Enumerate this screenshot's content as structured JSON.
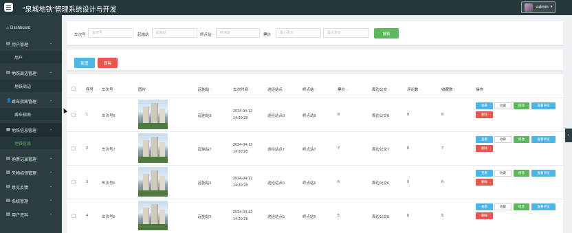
{
  "app": {
    "title": "“泉城地铁”管理系统设计与开发",
    "user": "admin",
    "caret": "▾"
  },
  "sidebar": {
    "items": [
      {
        "icon": "⌂",
        "icon_name": "home-icon",
        "label": "Dashboard",
        "chevron": ""
      },
      {
        "icon": "▤",
        "icon_name": "user-group-icon",
        "label": "用户管理",
        "chevron": "⌄"
      },
      {
        "sub": true,
        "label": "用户"
      },
      {
        "icon": "▤",
        "icon_name": "grid-icon",
        "label": "地铁周边管理",
        "chevron": "⌄"
      },
      {
        "sub": true,
        "label": "地铁周边"
      },
      {
        "icon": "👤",
        "icon_name": "guide-user-icon",
        "label": "乘车指南管理",
        "chevron": "⌄"
      },
      {
        "sub": true,
        "label": "乘车指南"
      },
      {
        "icon": "▦",
        "icon_name": "grid-icon",
        "label": "地铁信息管理",
        "chevron": "⌄",
        "active": true
      },
      {
        "sub": true,
        "label": "地铁信息",
        "active": true
      },
      {
        "icon": "▤",
        "icon_name": "ticket-icon",
        "label": "购票记录管理",
        "chevron": "⌄"
      },
      {
        "icon": "▤",
        "icon_name": "lost-found-icon",
        "label": "失物招领管理",
        "chevron": "⌄"
      },
      {
        "icon": "▤",
        "icon_name": "feedback-icon",
        "label": "意见反馈",
        "chevron": "⌄"
      },
      {
        "icon": "▤",
        "icon_name": "system-icon",
        "label": "系统管理",
        "chevron": "⌄"
      },
      {
        "icon": "▤",
        "icon_name": "profile-icon",
        "label": "用户资料",
        "chevron": "⌄"
      }
    ]
  },
  "search": {
    "train_no_label": "车次号",
    "train_no_placeholder": "车次号",
    "start_label": "起始站",
    "start_placeholder": "起始站",
    "end_label": "终点站",
    "end_placeholder": "终点站",
    "fare_label": "票价",
    "fare_min_placeholder": "最小票价",
    "fare_max_placeholder": "最大票价",
    "button": "搜索"
  },
  "actions": {
    "add": "新增",
    "delete": "删除"
  },
  "table": {
    "headers": {
      "seq": "序号",
      "train_no": "车次号",
      "image": "图片",
      "start": "起始站",
      "time": "车次时间",
      "via": "途经站点",
      "end": "终点站",
      "fare": "票价",
      "bus": "周边公交",
      "comments": "评论数",
      "favorites": "收藏数",
      "ops": "操作"
    },
    "sort_mark": "↕",
    "op_labels": {
      "view": "查看",
      "fav": "收藏",
      "edit": "修改",
      "comment": "查看评论",
      "delete": "删除"
    },
    "rows": [
      {
        "seq": "1",
        "train_no": "车次号8",
        "start": "起始站8",
        "time": "2024-04-12 14:39:28",
        "via": "途经站点8",
        "end": "终点站8",
        "fare": "8",
        "bus": "周边公交8",
        "comments": "0",
        "favorites": "8"
      },
      {
        "seq": "2",
        "train_no": "车次号7",
        "start": "起始站7",
        "time": "2024-04-12 14:39:28",
        "via": "途经站点7",
        "end": "终点站7",
        "fare": "7",
        "bus": "周边公交7",
        "comments": "0",
        "favorites": "7"
      },
      {
        "seq": "3",
        "train_no": "车次号6",
        "start": "起始站6",
        "time": "2024-04-12 14:39:28",
        "via": "途经站点6",
        "end": "终点站6",
        "fare": "6",
        "bus": "周边公交6",
        "comments": "0",
        "favorites": "6"
      },
      {
        "seq": "4",
        "train_no": "车次号5",
        "start": "起始站5",
        "time": "2024-04-12 14:39:28",
        "via": "途经站点5",
        "end": "终点站5",
        "fare": "5",
        "bus": "周边公交5",
        "comments": "0",
        "favorites": "5"
      }
    ]
  },
  "right_tab": "‹",
  "colors": {
    "topbar": "#24383c",
    "sidebar": "#2c3e40",
    "primary": "#4fb5e6",
    "success": "#5cb85c",
    "danger": "#e8574f"
  }
}
